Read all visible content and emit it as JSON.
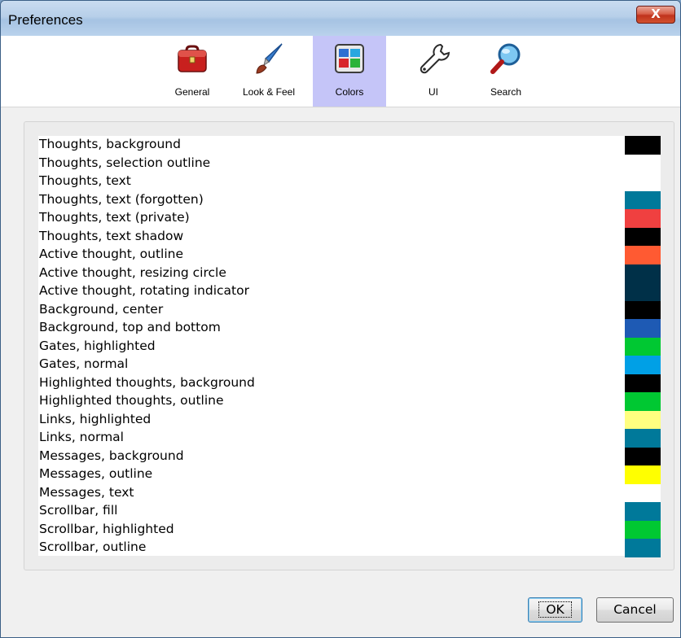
{
  "window": {
    "title": "Preferences",
    "close_glyph": "X"
  },
  "tabs": [
    {
      "label": "General",
      "icon": "toolbox-icon",
      "active": false
    },
    {
      "label": "Look & Feel",
      "icon": "paintbrush-icon",
      "active": false
    },
    {
      "label": "Colors",
      "icon": "color-palette-icon",
      "active": true
    },
    {
      "label": "UI",
      "icon": "wrench-icon",
      "active": false
    },
    {
      "label": "Search",
      "icon": "magnifier-icon",
      "active": false
    }
  ],
  "colors": [
    {
      "name": "Thoughts, background",
      "color": "#000000"
    },
    {
      "name": "Thoughts, selection outline",
      "color": "#ffffff"
    },
    {
      "name": "Thoughts, text",
      "color": "#ffffff"
    },
    {
      "name": "Thoughts, text (forgotten)",
      "color": "#00799a"
    },
    {
      "name": "Thoughts, text (private)",
      "color": "#f04040"
    },
    {
      "name": "Thoughts, text shadow",
      "color": "#000000"
    },
    {
      "name": "Active thought, outline",
      "color": "#ff5a32"
    },
    {
      "name": "Active thought, resizing circle",
      "color": "#003048"
    },
    {
      "name": "Active thought, rotating indicator",
      "color": "#003048"
    },
    {
      "name": "Background, center",
      "color": "#000000"
    },
    {
      "name": "Background, top and bottom",
      "color": "#1e5ab4"
    },
    {
      "name": "Gates, highlighted",
      "color": "#00c832"
    },
    {
      "name": "Gates, normal",
      "color": "#00a0e6"
    },
    {
      "name": "Highlighted thoughts, background",
      "color": "#000000"
    },
    {
      "name": "Highlighted thoughts, outline",
      "color": "#00c832"
    },
    {
      "name": "Links, highlighted",
      "color": "#ffff80"
    },
    {
      "name": "Links, normal",
      "color": "#00799a"
    },
    {
      "name": "Messages, background",
      "color": "#000000"
    },
    {
      "name": "Messages, outline",
      "color": "#ffff00"
    },
    {
      "name": "Messages, text",
      "color": "#ffffff"
    },
    {
      "name": "Scrollbar, fill",
      "color": "#00799a"
    },
    {
      "name": "Scrollbar, highlighted",
      "color": "#00c832"
    },
    {
      "name": "Scrollbar, outline",
      "color": "#00799a"
    }
  ],
  "buttons": {
    "ok": "OK",
    "cancel": "Cancel"
  }
}
